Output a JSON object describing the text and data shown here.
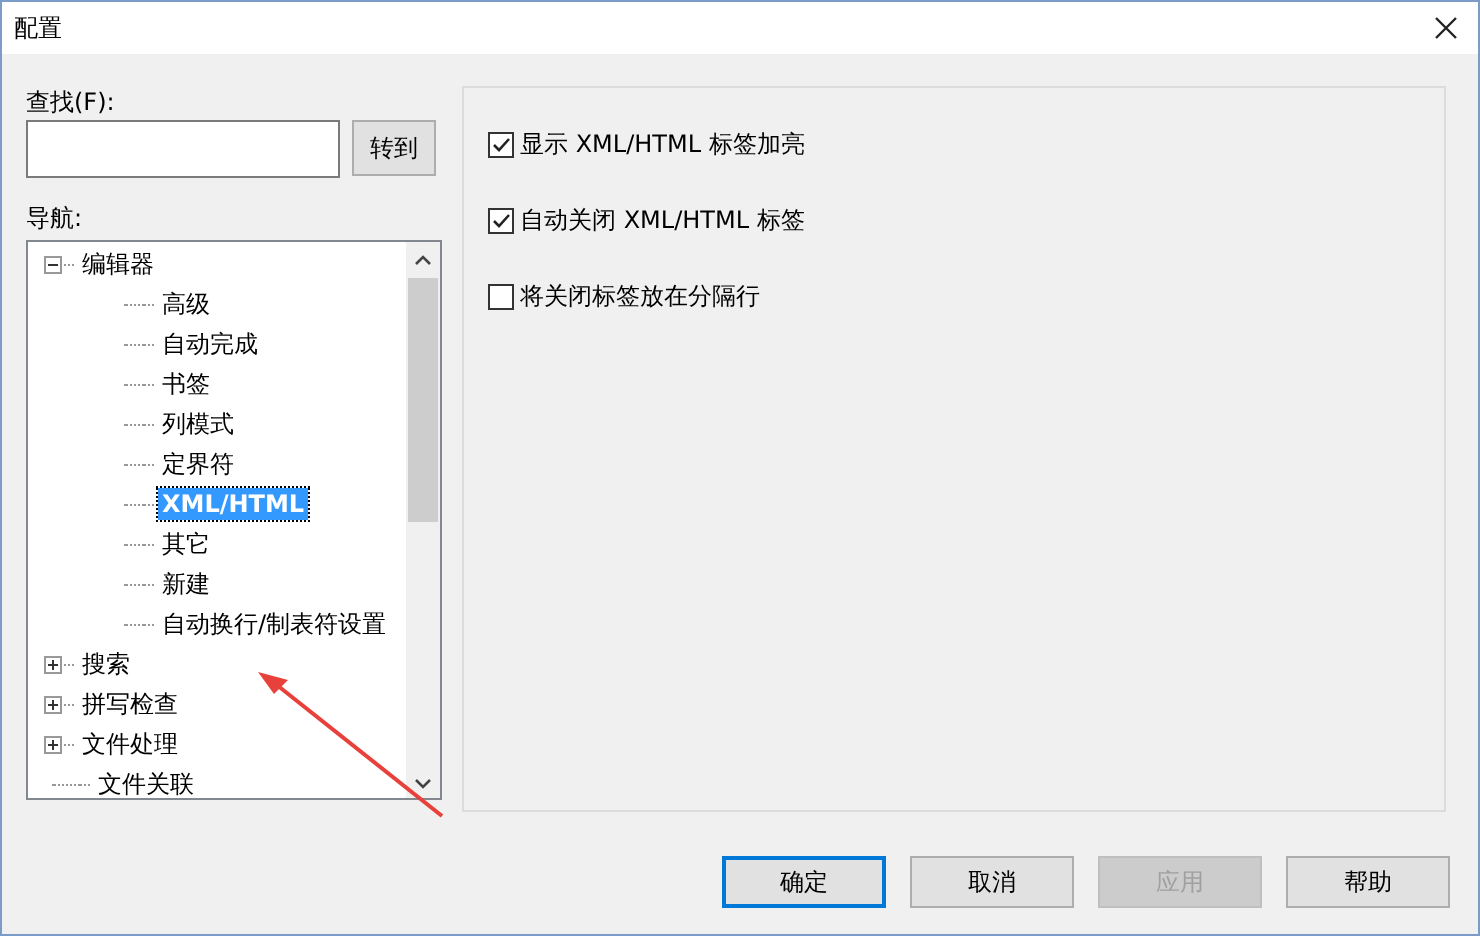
{
  "window": {
    "title": "配置"
  },
  "find": {
    "label": "查找(F):",
    "button": "转到"
  },
  "nav": {
    "label": "导航:",
    "tree": [
      {
        "label": "编辑器",
        "expanded": true,
        "selected": false,
        "children": [
          {
            "label": "高级",
            "selected": false
          },
          {
            "label": "自动完成",
            "selected": false
          },
          {
            "label": "书签",
            "selected": false
          },
          {
            "label": "列模式",
            "selected": false
          },
          {
            "label": "定界符",
            "selected": false
          },
          {
            "label": "XML/HTML",
            "selected": true
          },
          {
            "label": "其它",
            "selected": false
          },
          {
            "label": "新建",
            "selected": false
          },
          {
            "label": "自动换行/制表符设置",
            "selected": false
          }
        ]
      },
      {
        "label": "搜索",
        "expanded": false,
        "selected": false
      },
      {
        "label": "拼写检查",
        "expanded": false,
        "selected": false
      },
      {
        "label": "文件处理",
        "expanded": false,
        "selected": false
      },
      {
        "label": "文件关联",
        "selected": false
      }
    ]
  },
  "options": [
    {
      "label": "显示 XML/HTML 标签加亮",
      "checked": true
    },
    {
      "label": "自动关闭 XML/HTML 标签",
      "checked": true
    },
    {
      "label": "将关闭标签放在分隔行",
      "checked": false
    }
  ],
  "buttons": [
    {
      "label": "确定",
      "default": true,
      "disabled": false
    },
    {
      "label": "取消",
      "default": false,
      "disabled": false
    },
    {
      "label": "应用",
      "default": false,
      "disabled": true
    },
    {
      "label": "帮助",
      "default": false,
      "disabled": false
    }
  ]
}
